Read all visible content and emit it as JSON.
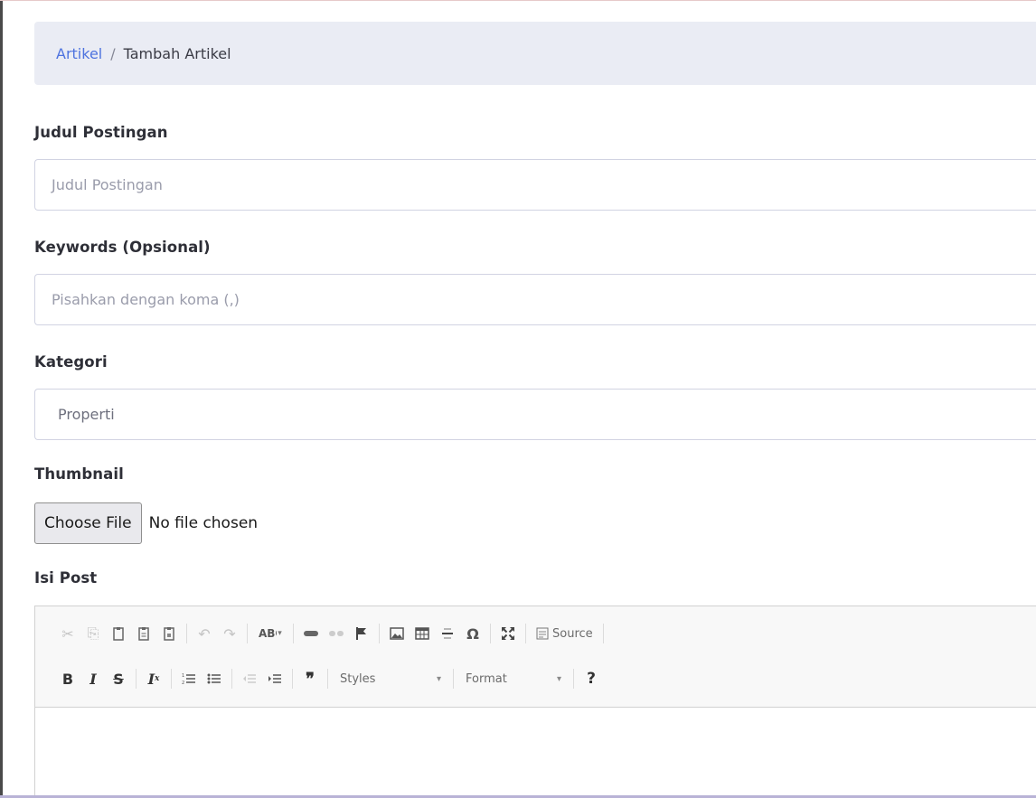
{
  "breadcrumb": {
    "parent": "Artikel",
    "separator": "/",
    "current": "Tambah Artikel"
  },
  "form": {
    "title": {
      "label": "Judul Postingan",
      "placeholder": "Judul Postingan"
    },
    "keywords": {
      "label": "Keywords (Opsional)",
      "placeholder": "Pisahkan dengan koma (,)"
    },
    "category": {
      "label": "Kategori",
      "value": "Properti"
    },
    "thumbnail": {
      "label": "Thumbnail",
      "button": "Choose File",
      "status": "No file chosen"
    },
    "content": {
      "label": "Isi Post"
    }
  },
  "editor": {
    "toolbar_row1": [
      "cut-icon",
      "copy-icon",
      "paste-icon",
      "paste-text-icon",
      "paste-word-icon",
      "undo-icon",
      "redo-icon",
      "spellcheck-icon",
      "link-icon",
      "unlink-icon",
      "anchor-icon",
      "image-icon",
      "table-icon",
      "horizontal-line-icon",
      "special-char-icon",
      "maximize-icon",
      "source-icon"
    ],
    "source_label": "Source",
    "toolbar_row2": [
      "bold-icon",
      "italic-icon",
      "strike-icon",
      "remove-format-icon",
      "numbered-list-icon",
      "bulleted-list-icon",
      "outdent-icon",
      "indent-icon",
      "blockquote-icon"
    ],
    "styles_label": "Styles",
    "format_label": "Format",
    "help_label": "?"
  },
  "colors": {
    "link": "#4e73df",
    "breadcrumb_bg": "#eaecf4",
    "border": "#d1d3e2"
  }
}
